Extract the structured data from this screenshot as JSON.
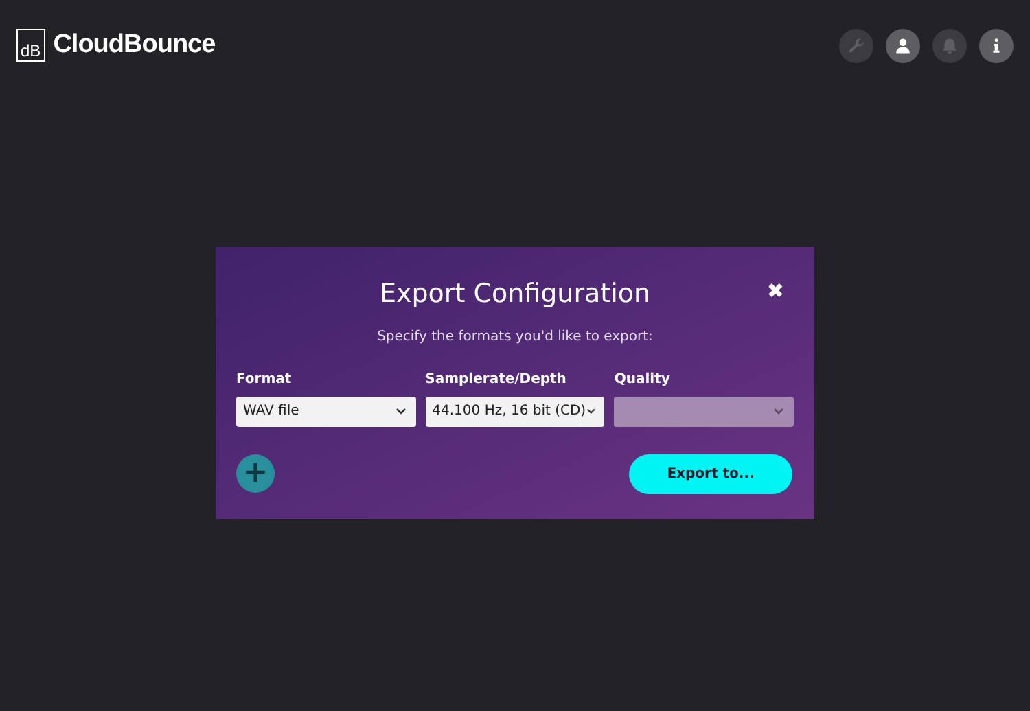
{
  "app": {
    "logo_mark": "dB",
    "name": "CloudBounce"
  },
  "header_icons": [
    {
      "kind": "wrench",
      "enabled": false
    },
    {
      "kind": "user",
      "enabled": true
    },
    {
      "kind": "bell",
      "enabled": false
    },
    {
      "kind": "info",
      "enabled": true
    }
  ],
  "dialog": {
    "title": "Export Configuration",
    "close": "✖",
    "subtitle": "Specify the formats you'd like to export:",
    "fields": [
      {
        "label": "Format",
        "value": "WAV file",
        "disabled": false
      },
      {
        "label": "Samplerate/Depth",
        "value": "44.100 Hz, 16 bit (CD)",
        "disabled": false
      },
      {
        "label": "Quality",
        "disabled": true
      }
    ],
    "add_button": {
      "label": "+",
      "disabled": true
    },
    "export_button": "Export to..."
  }
}
